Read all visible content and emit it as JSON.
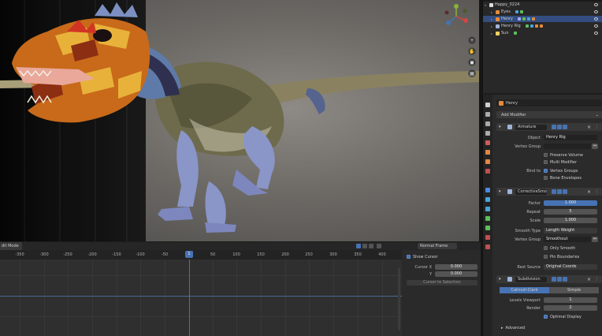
{
  "viewport": {
    "gizmo_axes": [
      "X",
      "Y",
      "Z"
    ]
  },
  "outliner": {
    "rows": [
      {
        "label": "Happy_0224",
        "selected": false
      },
      {
        "label": "Eyes",
        "selected": false
      },
      {
        "label": "Henry",
        "selected": true
      },
      {
        "label": "Henry Rig",
        "selected": false
      },
      {
        "label": "Sun",
        "selected": false
      }
    ]
  },
  "properties": {
    "object_name": "Henry",
    "add_modifier": "Add Modifier",
    "armature": {
      "name": "Armature",
      "object_label": "Object",
      "object_value": "Henry Rig",
      "vertex_group_label": "Vertex Group",
      "preserve_volume": "Preserve Volume",
      "multi_modifier": "Multi Modifier",
      "bind_to_label": "Bind to",
      "vertex_groups": "Vertex Groups",
      "bone_envelopes": "Bone Envelopes"
    },
    "corrective": {
      "name": "CorrectiveSmo...",
      "factor_label": "Factor",
      "factor_value": "1.000",
      "repeat_label": "Repeat",
      "repeat_value": "5",
      "scale_label": "Scale",
      "scale_value": "1.000",
      "smooth_type_label": "Smooth Type",
      "smooth_type_value": "Length Weight",
      "vertex_group_label": "Vertex Group",
      "vertex_group_value": "Smoothout",
      "only_smooth": "Only Smooth",
      "pin_boundaries": "Pin Boundaries",
      "rest_source_label": "Rest Source",
      "rest_source_value": "Original Coords"
    },
    "subdivision": {
      "name": "Subdivision",
      "catmull": "Catmull-Clark",
      "simple": "Simple",
      "levels_viewport_label": "Levels Viewport",
      "levels_viewport_value": "1",
      "render_label": "Render",
      "render_value": "2",
      "optimal_display": "Optimal Display",
      "advanced": "Advanced"
    }
  },
  "timeline": {
    "left_label": "dit Mode",
    "normalize_label": "Normal Frame",
    "ruler": [
      "-350",
      "-300",
      "-250",
      "-200",
      "-150",
      "-100",
      "-50",
      "1",
      "50",
      "100",
      "150",
      "200",
      "250",
      "300",
      "350",
      "400"
    ],
    "current_frame": "1",
    "show_cursor": "Show Cursor",
    "cursor_x_label": "Cursor X",
    "cursor_x_value": "0.000",
    "cursor_y_label": "Y",
    "cursor_y_value": "0.000",
    "cursor_to_selection": "Cursor to Selection"
  },
  "colors": {
    "accent": "#4772b3",
    "selection": "#334d80",
    "panel": "#2b2b2b"
  }
}
